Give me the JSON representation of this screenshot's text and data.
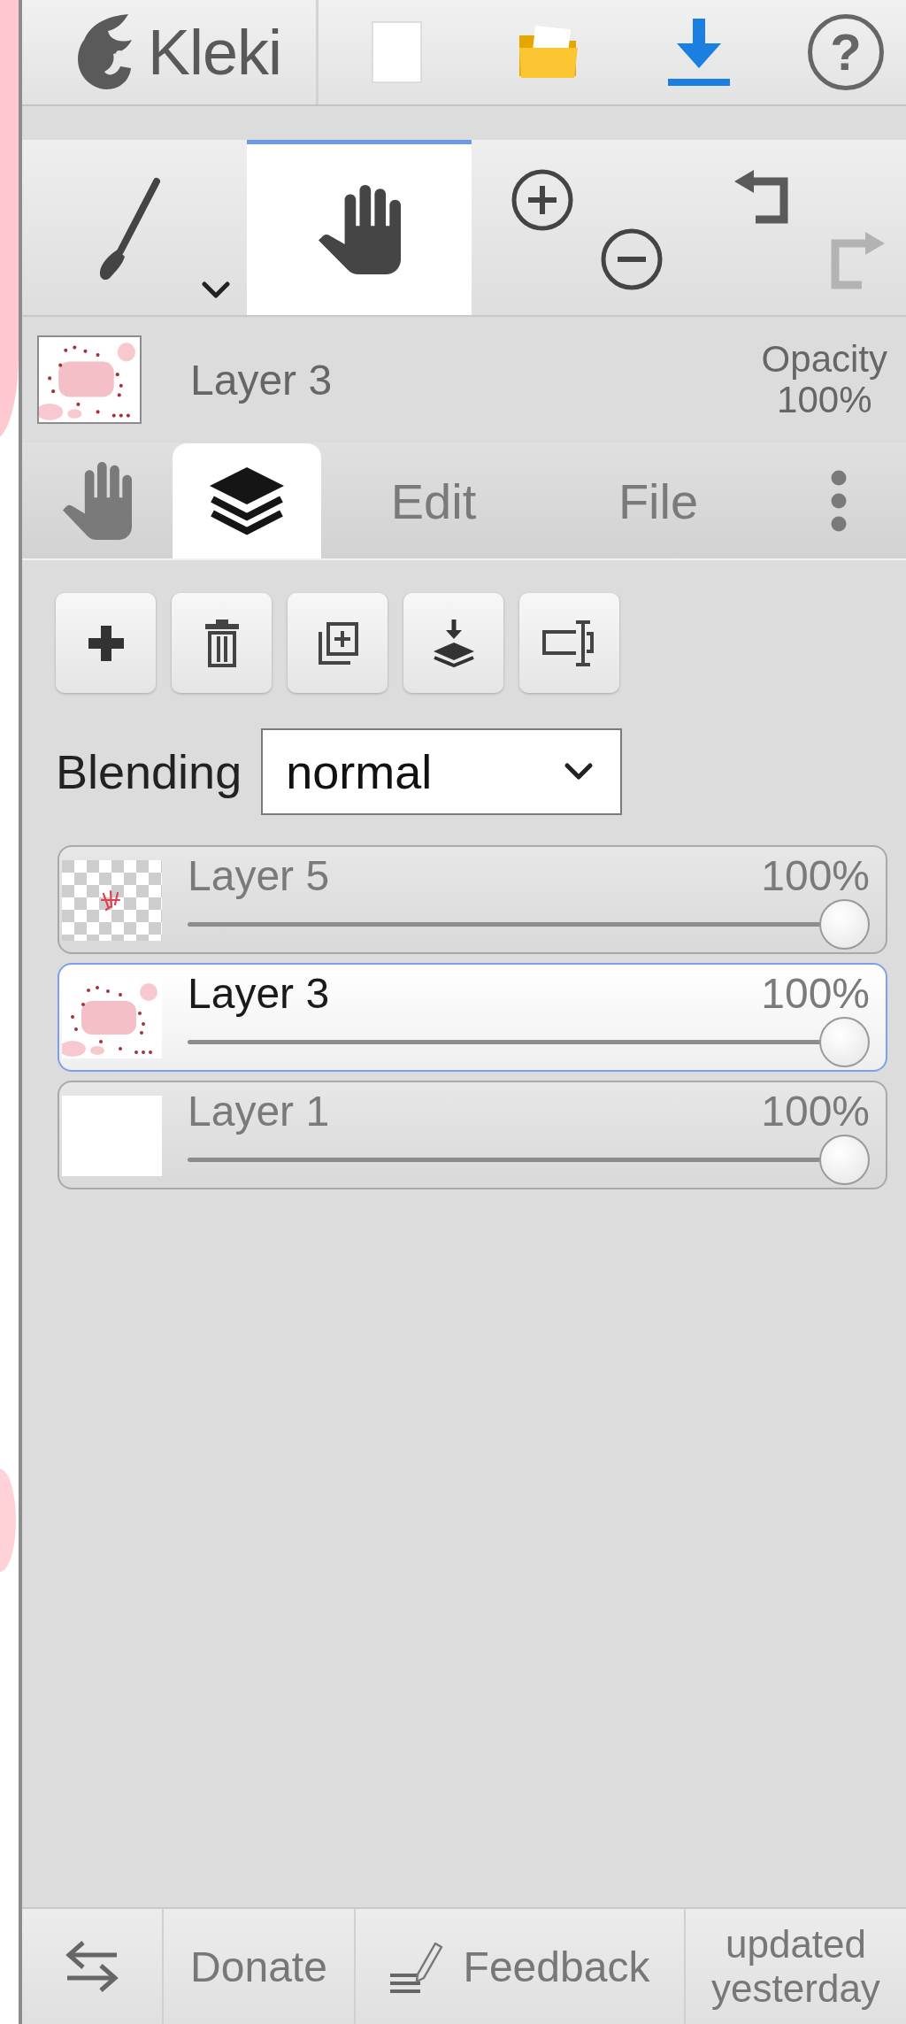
{
  "top_bar": {
    "logo": "Kleki",
    "help": "?"
  },
  "tools": [
    {
      "kind": "brush",
      "selected": false
    },
    {
      "kind": "hand",
      "selected": true
    }
  ],
  "history": {
    "undo": {
      "disabled": false
    },
    "redo": {
      "disabled": true
    }
  },
  "current_layer": {
    "kind": "painted",
    "name": "Layer 3",
    "opacity_label": "Opacity",
    "opacity": "100%"
  },
  "tabs": [
    {
      "kind": "hand",
      "selected": false
    },
    {
      "kind": "layers",
      "selected": true
    },
    {
      "kind": "text",
      "label": "Edit",
      "selected": false
    },
    {
      "kind": "text",
      "label": "File",
      "selected": false
    }
  ],
  "layers_panel": {
    "blending": {
      "label": "Blending",
      "value": "normal"
    },
    "layers": [
      {
        "kind": "transparent",
        "name": "Layer 5",
        "opacity": "100%",
        "level": 1,
        "selected": false
      },
      {
        "kind": "painted",
        "name": "Layer 3",
        "opacity": "100%",
        "level": 1,
        "selected": true
      },
      {
        "kind": "blank",
        "name": "Layer 1",
        "opacity": "100%",
        "level": 1,
        "selected": false
      }
    ]
  },
  "footer": {
    "donate": "Donate",
    "feedback": "Feedback",
    "updated": "updated yesterday"
  }
}
